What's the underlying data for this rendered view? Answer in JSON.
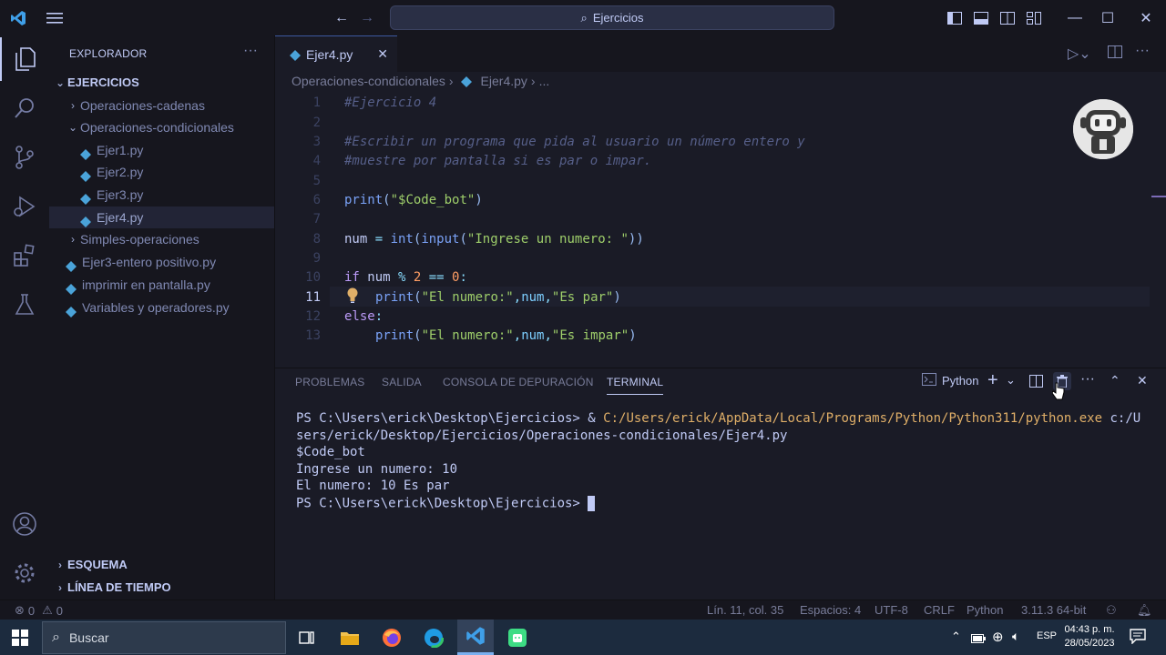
{
  "titlebar": {
    "search_text": "Ejercicios"
  },
  "sidebar": {
    "header": "EXPLORADOR",
    "root": "EJERCICIOS",
    "items": [
      {
        "label": "Operaciones-cadenas",
        "type": "folder",
        "expanded": false
      },
      {
        "label": "Operaciones-condicionales",
        "type": "folder",
        "expanded": true
      },
      {
        "label": "Ejer1.py",
        "type": "file"
      },
      {
        "label": "Ejer2.py",
        "type": "file"
      },
      {
        "label": "Ejer3.py",
        "type": "file"
      },
      {
        "label": "Ejer4.py",
        "type": "file",
        "selected": true
      },
      {
        "label": "Simples-operaciones",
        "type": "folder",
        "expanded": false
      },
      {
        "label": "Ejer3-entero positivo.py",
        "type": "file"
      },
      {
        "label": "imprimir en pantalla.py",
        "type": "file"
      },
      {
        "label": "Variables y operadores.py",
        "type": "file"
      }
    ],
    "outline": "ESQUEMA",
    "timeline": "LÍNEA DE TIEMPO"
  },
  "editor": {
    "tab_label": "Ejer4.py",
    "breadcrumb": [
      "Operaciones-condicionales",
      "Ejer4.py",
      "..."
    ],
    "line_numbers": [
      "1",
      "2",
      "3",
      "4",
      "5",
      "6",
      "7",
      "8",
      "9",
      "10",
      "11",
      "12",
      "13"
    ],
    "current_line": "11"
  },
  "panel": {
    "tabs": [
      "PROBLEMAS",
      "SALIDA",
      "CONSOLA DE DEPURACIÓN",
      "TERMINAL"
    ],
    "active_tab": "TERMINAL",
    "shell_label": "Python",
    "terminal_lines": [
      "PS C:\\Users\\erick\\Desktop\\Ejercicios> & ",
      "C:/Users/erick/AppData/Local/Programs/Python/Python311/python.exe",
      " c:/U",
      "sers/erick/Desktop/Ejercicios/Operaciones-condicionales/Ejer4.py",
      "$Code_bot",
      "Ingrese un numero: 10",
      "El numero: 10 Es par",
      "PS C:\\Users\\erick\\Desktop\\Ejercicios> "
    ]
  },
  "statusbar": {
    "errors": "0",
    "warnings": "0",
    "position": "Lín. 11, col. 35",
    "spaces": "Espacios: 4",
    "encoding": "UTF-8",
    "eol": "CRLF",
    "language": "Python",
    "version": "3.11.3 64-bit"
  },
  "taskbar": {
    "search": "Buscar",
    "language": "ESP",
    "time": "04:43 p. m.",
    "date": "28/05/2023"
  },
  "colors": {
    "keyword": "#bb9af7",
    "function": "#7aa2f7",
    "string": "#9ece6a",
    "comment": "#565f89",
    "number": "#ff9e64",
    "variable": "#c0caf5",
    "orange_path": "#e0af68"
  }
}
